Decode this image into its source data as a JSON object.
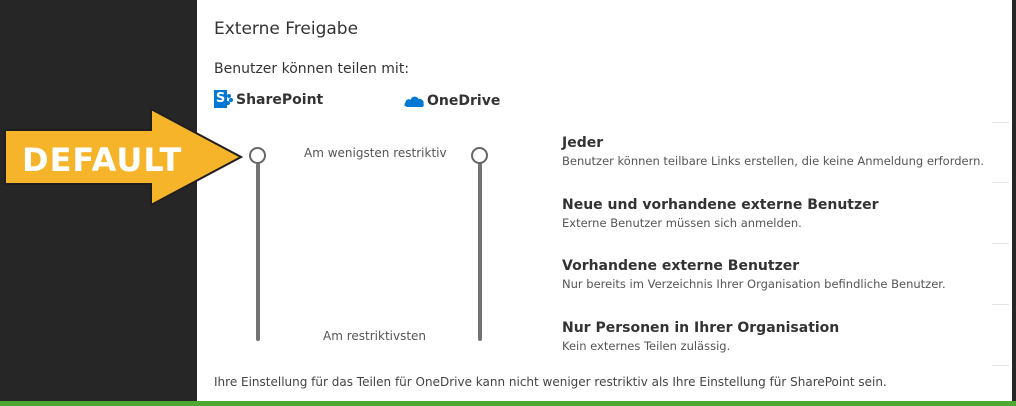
{
  "panel": {
    "title": "Externe Freigabe",
    "share_label": "Benutzer können teilen mit:",
    "sharepoint_label": "SharePoint",
    "onedrive_label": "OneDrive"
  },
  "slider": {
    "least_label": "Am wenigsten restriktiv",
    "most_label": "Am restriktivsten"
  },
  "options": [
    {
      "title": "Jeder",
      "desc": "Benutzer können teilbare Links erstellen, die keine Anmeldung erfordern."
    },
    {
      "title": "Neue und vorhandene externe Benutzer",
      "desc": "Externe Benutzer müssen sich anmelden."
    },
    {
      "title": "Vorhandene externe Benutzer",
      "desc": "Nur bereits im Verzeichnis Ihrer Organisation befindliche Benutzer."
    },
    {
      "title": "Nur Personen in Ihrer Organisation",
      "desc": "Kein externes Teilen zulässig."
    }
  ],
  "footer_note": "Ihre Einstellung für das Teilen für OneDrive kann nicht weniger restriktiv als Ihre Einstellung für SharePoint sein.",
  "callout": {
    "text": "DEFAULT"
  },
  "colors": {
    "sharepoint_blue": "#0078d4",
    "onedrive_blue": "#0078d4",
    "callout_arrow": "#f5b42a",
    "bottom_bar": "#4ea72e"
  }
}
